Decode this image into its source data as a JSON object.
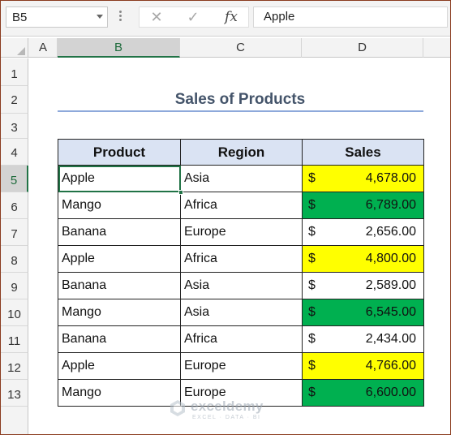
{
  "formula_bar": {
    "name_box": "B5",
    "cancel_glyph": "✕",
    "enter_glyph": "✓",
    "fx_label": "fx",
    "formula_value": "Apple"
  },
  "columns": [
    "A",
    "B",
    "C",
    "D"
  ],
  "selected_column": "B",
  "rows": [
    "1",
    "2",
    "3",
    "4",
    "5",
    "6",
    "7",
    "8",
    "9",
    "10",
    "11",
    "12",
    "13"
  ],
  "selected_row": "5",
  "sheet": {
    "title": "Sales of Products",
    "headers": [
      "Product",
      "Region",
      "Sales"
    ],
    "records": [
      {
        "product": "Apple",
        "region": "Asia",
        "currency": "$",
        "sales": "4,678.00",
        "fill": "yellow"
      },
      {
        "product": "Mango",
        "region": "Africa",
        "currency": "$",
        "sales": "6,789.00",
        "fill": "green"
      },
      {
        "product": "Banana",
        "region": "Europe",
        "currency": "$",
        "sales": "2,656.00",
        "fill": "none"
      },
      {
        "product": "Apple",
        "region": "Africa",
        "currency": "$",
        "sales": "4,800.00",
        "fill": "yellow"
      },
      {
        "product": "Banana",
        "region": "Asia",
        "currency": "$",
        "sales": "2,589.00",
        "fill": "none"
      },
      {
        "product": "Mango",
        "region": "Asia",
        "currency": "$",
        "sales": "6,545.00",
        "fill": "green"
      },
      {
        "product": "Banana",
        "region": "Africa",
        "currency": "$",
        "sales": "2,434.00",
        "fill": "none"
      },
      {
        "product": "Apple",
        "region": "Europe",
        "currency": "$",
        "sales": "4,766.00",
        "fill": "yellow"
      },
      {
        "product": "Mango",
        "region": "Europe",
        "currency": "$",
        "sales": "6,600.00",
        "fill": "green"
      }
    ]
  },
  "colors": {
    "highlight_yellow": "#ffff00",
    "highlight_green": "#00b050",
    "header_fill": "#dae3f3",
    "title_color": "#44546a",
    "selection_green": "#217346"
  },
  "watermark": {
    "name": "exceldemy",
    "tagline": "EXCEL · DATA · BI"
  }
}
